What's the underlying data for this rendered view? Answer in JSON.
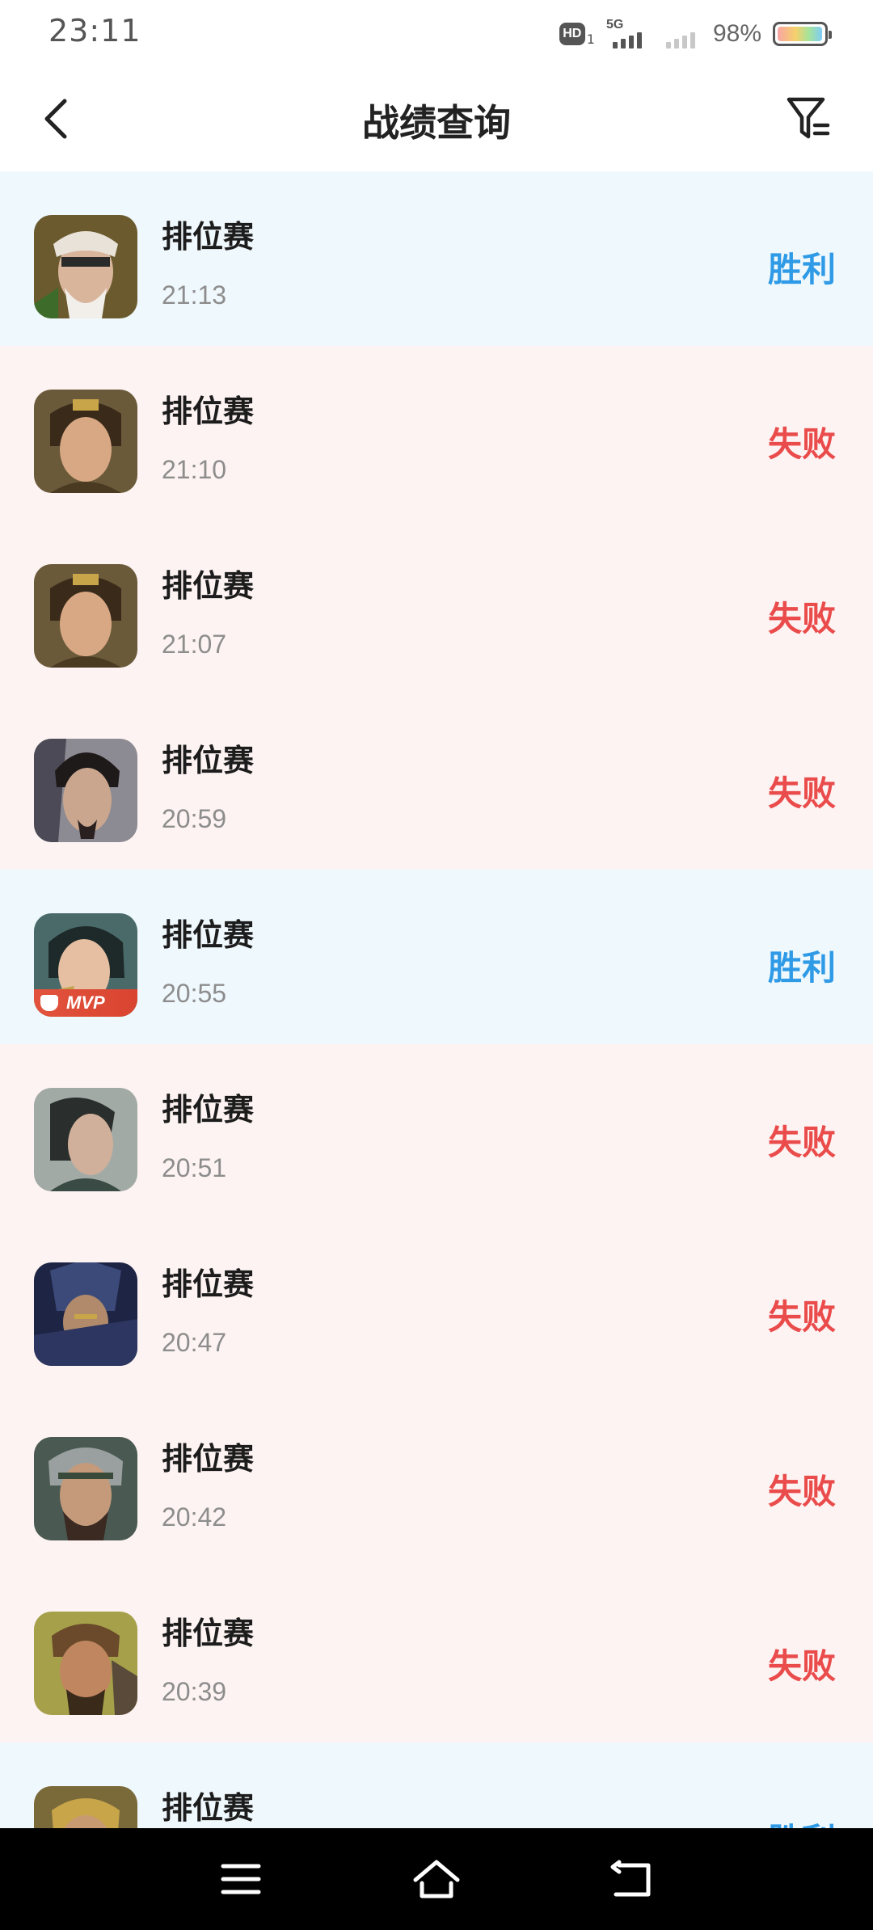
{
  "status_bar": {
    "time": "23:11",
    "hd_label": "HD",
    "hd_sub": "1",
    "network_label": "5G",
    "battery_percent": "98%"
  },
  "header": {
    "title": "战绩查询",
    "back_icon": "chevron-left-icon",
    "filter_icon": "filter-icon"
  },
  "colors": {
    "win_background": "#eff8fd",
    "loss_background": "#fdf3f2",
    "win_text": "#2f9ae6",
    "loss_text": "#ea4b4b"
  },
  "matches": [
    {
      "mode": "排位赛",
      "time": "21:13",
      "result": "胜利",
      "outcome": "win"
    },
    {
      "mode": "排位赛",
      "time": "21:10",
      "result": "失败",
      "outcome": "loss"
    },
    {
      "mode": "排位赛",
      "time": "21:07",
      "result": "失败",
      "outcome": "loss"
    },
    {
      "mode": "排位赛",
      "time": "20:59",
      "result": "失败",
      "outcome": "loss"
    },
    {
      "mode": "排位赛",
      "time": "20:55",
      "result": "胜利",
      "outcome": "win",
      "badge": "MVP"
    },
    {
      "mode": "排位赛",
      "time": "20:51",
      "result": "失败",
      "outcome": "loss"
    },
    {
      "mode": "排位赛",
      "time": "20:47",
      "result": "失败",
      "outcome": "loss"
    },
    {
      "mode": "排位赛",
      "time": "20:42",
      "result": "失败",
      "outcome": "loss"
    },
    {
      "mode": "排位赛",
      "time": "20:39",
      "result": "失败",
      "outcome": "loss"
    },
    {
      "mode": "排位赛",
      "time": "",
      "result": "胜利",
      "outcome": "win"
    }
  ],
  "nav_bar": {
    "menu_icon": "menu-icon",
    "home_icon": "home-icon",
    "back_icon": "back-icon"
  }
}
